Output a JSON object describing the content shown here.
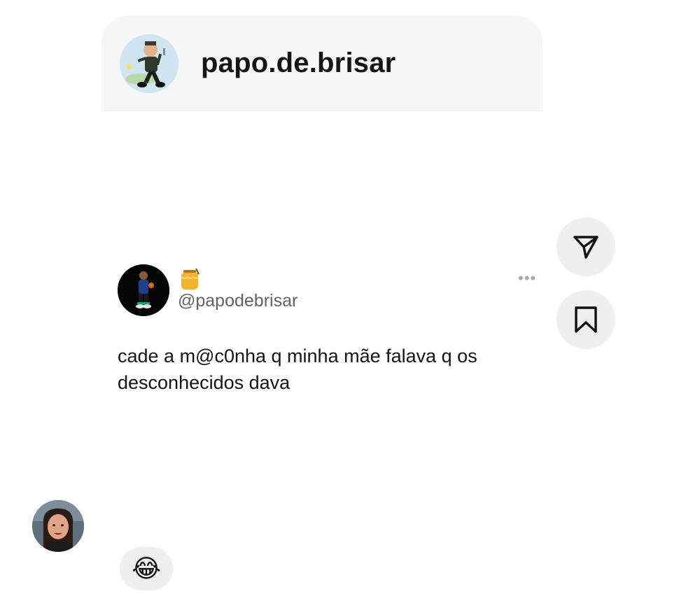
{
  "shared_post": {
    "username": "papo.de.brisar",
    "avatar_icon": "cartoon-character-avatar"
  },
  "tweet": {
    "avatar_icon": "basketball-player-avatar",
    "badge_icon": "honey-pot-icon",
    "handle": "@papodebrisar",
    "more_label": "•••",
    "text": "cade a m@c0nha q minha mãe falava q os desconhecidos dava"
  },
  "actions": {
    "share_icon": "send-icon",
    "save_icon": "bookmark-icon"
  },
  "message": {
    "sender_avatar_icon": "woman-profile-avatar",
    "reply_emoji": "😂"
  },
  "colors": {
    "header_background": "#f5f6f5",
    "button_background": "#efefef",
    "handle_text": "#606366"
  }
}
